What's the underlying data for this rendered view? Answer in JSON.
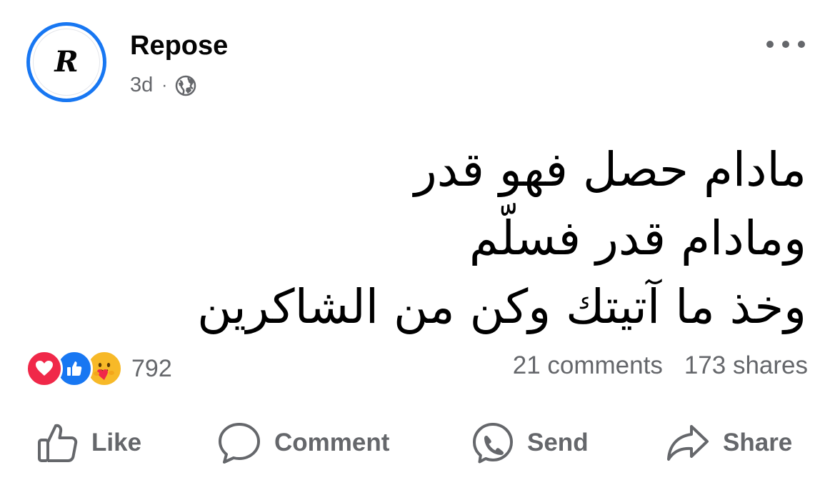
{
  "post": {
    "author": {
      "name": "Repose",
      "avatar_letter": "R"
    },
    "meta": {
      "time": "3d",
      "separator": "·",
      "audience_icon": "globe-icon"
    },
    "more_icon": "more-options-icon",
    "text_lines": [
      "مادام حصل فهو قدر",
      "ومادام قدر فسلّم",
      "وخذ ما آتيتك وكن من الشاكرين"
    ],
    "reactions": {
      "icons": [
        "love-reaction-icon",
        "like-reaction-icon",
        "care-reaction-icon"
      ],
      "count": "792"
    },
    "engagement": {
      "comments": "21 comments",
      "shares": "173 shares"
    },
    "actions": [
      {
        "label": "Like",
        "icon": "thumbs-up-icon"
      },
      {
        "label": "Comment",
        "icon": "comment-bubble-icon"
      },
      {
        "label": "Send",
        "icon": "messenger-icon"
      },
      {
        "label": "Share",
        "icon": "share-arrow-icon"
      }
    ],
    "colors": {
      "accent": "#1877f2",
      "secondary_text": "#65676b",
      "love": "#f02849",
      "like": "#1877f2",
      "care": "#f7b928"
    }
  }
}
